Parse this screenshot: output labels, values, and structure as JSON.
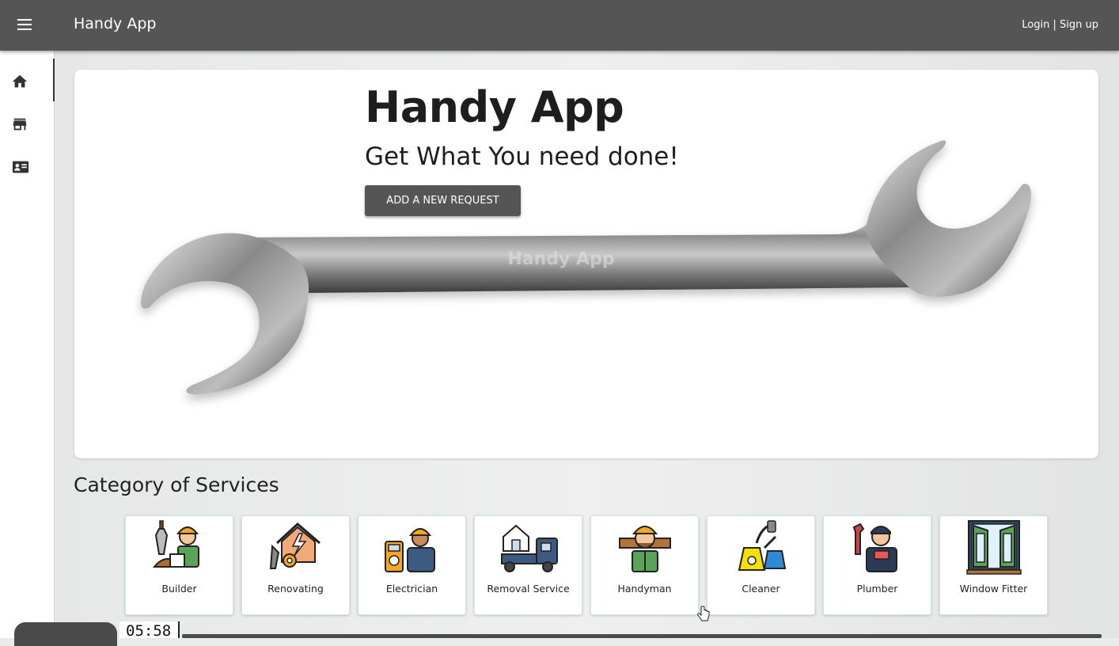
{
  "appbar": {
    "menu_icon": "hamburger-menu-icon",
    "title": "Handy App",
    "auth_link": "Login | Sign up"
  },
  "siderail": {
    "items": [
      {
        "icon": "home-icon",
        "active": true
      },
      {
        "icon": "store-icon",
        "active": false
      },
      {
        "icon": "id-card-icon",
        "active": false
      }
    ]
  },
  "hero": {
    "title": "Handy App",
    "subtitle": "Get What You need done!",
    "button_label": "ADD A NEW REQUEST",
    "wrench_engraving": "Handy App"
  },
  "categories": {
    "heading": "Category of Services",
    "items": [
      {
        "label": "Builder",
        "icon": "builder-icon"
      },
      {
        "label": "Renovating",
        "icon": "renovating-icon"
      },
      {
        "label": "Electrician",
        "icon": "electrician-icon"
      },
      {
        "label": "Removal Service",
        "icon": "removal-truck-icon"
      },
      {
        "label": "Handyman",
        "icon": "handyman-icon"
      },
      {
        "label": "Cleaner",
        "icon": "pressure-washer-icon"
      },
      {
        "label": "Plumber",
        "icon": "plumber-icon"
      },
      {
        "label": "Window Fitter",
        "icon": "window-icon"
      }
    ]
  },
  "video_overlay": {
    "timestamp": "05:58"
  },
  "colors": {
    "appbar": "#555555",
    "button": "#555555",
    "card_border": "#cfe7e3"
  }
}
